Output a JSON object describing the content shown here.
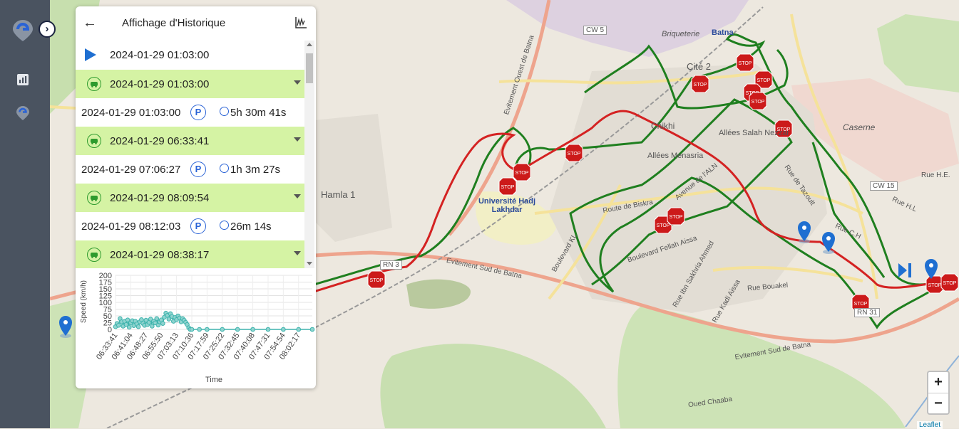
{
  "sidebar": {
    "logo": "location-logo",
    "toggle_glyph": "›",
    "items": [
      {
        "icon": "report-chart-icon"
      },
      {
        "icon": "location-pin-icon"
      }
    ]
  },
  "panel": {
    "title": "Affichage d'Historique",
    "back_glyph": "←",
    "start_row": {
      "datetime": "2024-01-29 01:03:00"
    },
    "rows": [
      {
        "type": "trip",
        "datetime": "2024-01-29 01:03:00"
      },
      {
        "type": "stop",
        "datetime": "2024-01-29 01:03:00",
        "parking": "P",
        "duration": "5h 30m 41s"
      },
      {
        "type": "trip",
        "datetime": "2024-01-29 06:33:41"
      },
      {
        "type": "stop",
        "datetime": "2024-01-29 07:06:27",
        "parking": "P",
        "duration": "1h 3m 27s"
      },
      {
        "type": "trip",
        "datetime": "2024-01-29 08:09:54"
      },
      {
        "type": "stop",
        "datetime": "2024-01-29 08:12:03",
        "parking": "P",
        "duration": "26m 14s"
      },
      {
        "type": "trip",
        "datetime": "2024-01-29 08:38:17"
      }
    ]
  },
  "chart_data": {
    "type": "line",
    "ylabel": "Speed (km/h)",
    "xlabel": "Time",
    "ylim": [
      0,
      200
    ],
    "yticks": [
      0,
      25,
      50,
      75,
      100,
      125,
      150,
      175,
      200
    ],
    "ytick_labels": [
      "0",
      "25",
      "50",
      "75",
      "100",
      "125",
      "150",
      "175",
      "200"
    ],
    "categories": [
      "06:33:41",
      "06:41:04",
      "06:48:27",
      "06:55:50",
      "07:03:13",
      "07:10:36",
      "07:17:59",
      "07:25:22",
      "07:32:45",
      "07:40:08",
      "07:47:31",
      "07:54:54",
      "08:02:17"
    ],
    "grid": true,
    "color": "#3fb4ad",
    "series": [
      {
        "x": [
          0,
          0.1,
          0.2,
          0.3,
          0.4,
          0.5,
          0.6,
          0.7,
          0.8,
          0.9,
          1,
          1.1,
          1.2,
          1.3,
          1.4,
          1.5,
          1.6,
          1.7,
          1.8,
          1.9,
          2,
          2.1,
          2.2,
          2.3,
          2.4,
          2.5,
          2.6,
          2.7,
          2.8,
          2.9,
          3,
          3.1,
          3.2,
          3.3,
          3.4,
          3.5,
          3.6,
          3.7,
          3.8,
          3.9,
          4,
          4.1,
          4.2,
          4.3,
          4.4,
          4.5,
          4.6,
          4.7,
          4.8,
          4.9,
          5,
          5.5,
          6,
          7,
          8,
          9,
          10,
          11,
          12,
          12.9
        ],
        "values": [
          10,
          22,
          15,
          40,
          28,
          12,
          30,
          18,
          35,
          8,
          25,
          32,
          14,
          30,
          20,
          10,
          28,
          36,
          22,
          15,
          34,
          18,
          26,
          38,
          12,
          30,
          24,
          40,
          16,
          28,
          35,
          22,
          45,
          60,
          52,
          38,
          58,
          48,
          30,
          44,
          36,
          50,
          42,
          28,
          40,
          34,
          26,
          18,
          6,
          0,
          0,
          0,
          0,
          0,
          0,
          0,
          0,
          0,
          0,
          0
        ]
      }
    ]
  },
  "map": {
    "labels": [
      "Batna",
      "Cité 2",
      "Briqueterie",
      "Chikhi",
      "Allées Menasria",
      "Allées Salah Nezzar",
      "Caserne",
      "Hamla 1",
      "Université Hadj Lakhdar",
      "CW 5",
      "CW 15",
      "RN 3",
      "RN 31",
      "Evitement Sud de Batna",
      "Evitement Sud de Batna",
      "Evitement Ouest de Batna",
      "Route de Biskra",
      "Avenue de l'ALN",
      "Boulevard Fellah Aissa",
      "Rue Bouakel",
      "Rue de Tazoult",
      "Rue Ibn Sakhria Ahmed",
      "Rue Kadi Aissa",
      "Boulevard KL",
      "Rue H.E.",
      "Rue H.L",
      "Rue C.H",
      "Oued Chaaba"
    ],
    "stop_sign_label": "STOP",
    "zoom_in": "+",
    "zoom_out": "−",
    "attribution": "Leaflet"
  }
}
